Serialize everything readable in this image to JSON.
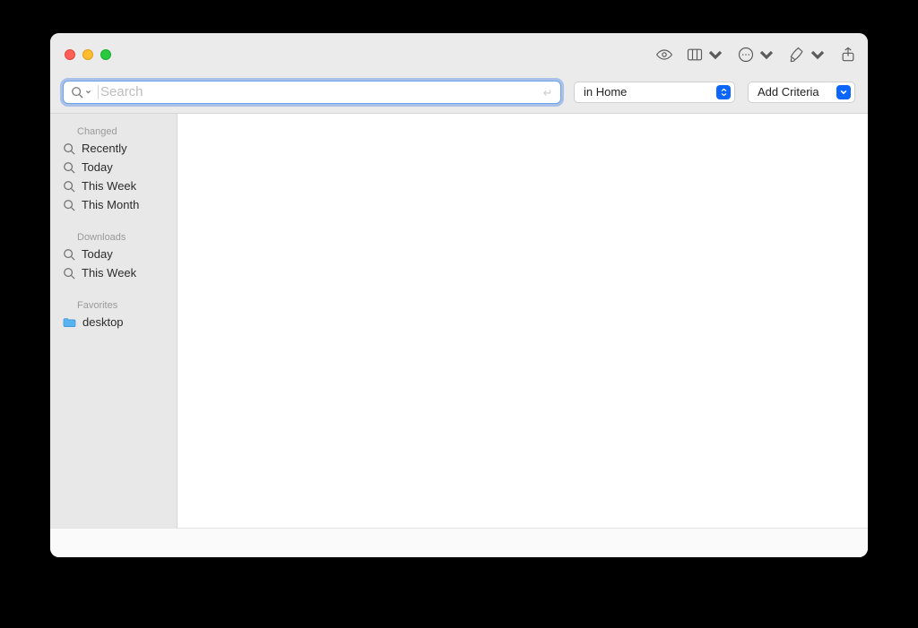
{
  "toolbar": {
    "search_placeholder": "Search",
    "scope_label": "in Home",
    "criteria_label": "Add Criteria"
  },
  "sidebar": {
    "sections": [
      {
        "title": "Changed",
        "items": [
          "Recently",
          "Today",
          "This Week",
          "This Month"
        ]
      },
      {
        "title": "Downloads",
        "items": [
          "Today",
          "This Week"
        ]
      },
      {
        "title": "Favorites",
        "items": [
          "desktop"
        ]
      }
    ]
  }
}
